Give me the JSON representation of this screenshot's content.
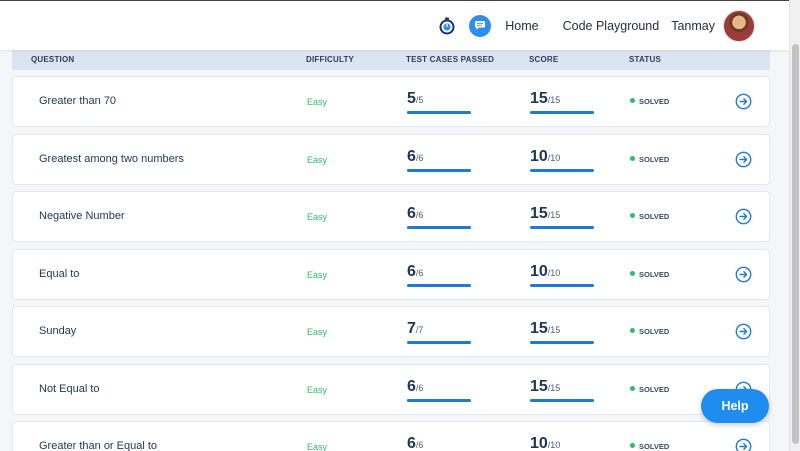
{
  "nav": {
    "home": "Home",
    "playground": "Code Playground",
    "user": "Tanmay",
    "icons": {
      "timer": "timer-icon",
      "chat": "chat-icon",
      "avatar": "avatar"
    }
  },
  "table": {
    "headers": {
      "question": "QUESTION",
      "difficulty": "DIFFICULTY",
      "test_cases": "TEST CASES PASSED",
      "score": "SCORE",
      "status": "STATUS"
    },
    "rows": [
      {
        "question": "Greater than 70",
        "difficulty": "Easy",
        "tc_passed": "5",
        "tc_total": "/5",
        "score": "15",
        "score_total": "/15",
        "status": "SOLVED"
      },
      {
        "question": "Greatest among two numbers",
        "difficulty": "Easy",
        "tc_passed": "6",
        "tc_total": "/6",
        "score": "10",
        "score_total": "/10",
        "status": "SOLVED"
      },
      {
        "question": "Negative Number",
        "difficulty": "Easy",
        "tc_passed": "6",
        "tc_total": "/6",
        "score": "15",
        "score_total": "/15",
        "status": "SOLVED"
      },
      {
        "question": "Equal to",
        "difficulty": "Easy",
        "tc_passed": "6",
        "tc_total": "/6",
        "score": "10",
        "score_total": "/10",
        "status": "SOLVED"
      },
      {
        "question": "Sunday",
        "difficulty": "Easy",
        "tc_passed": "7",
        "tc_total": "/7",
        "score": "15",
        "score_total": "/15",
        "status": "SOLVED"
      },
      {
        "question": "Not Equal to",
        "difficulty": "Easy",
        "tc_passed": "6",
        "tc_total": "/6",
        "score": "15",
        "score_total": "/15",
        "status": "SOLVED"
      },
      {
        "question": "Greater than or Equal to",
        "difficulty": "Easy",
        "tc_passed": "6",
        "tc_total": "/6",
        "score": "10",
        "score_total": "/10",
        "status": "SOLVED"
      }
    ],
    "progress_fraction": 1.0
  },
  "help": {
    "label": "Help"
  },
  "colors": {
    "accent": "#1f8cf0",
    "easy": "#2ebd6b",
    "header_bg": "#dce4f3",
    "text": "#1f3556"
  }
}
